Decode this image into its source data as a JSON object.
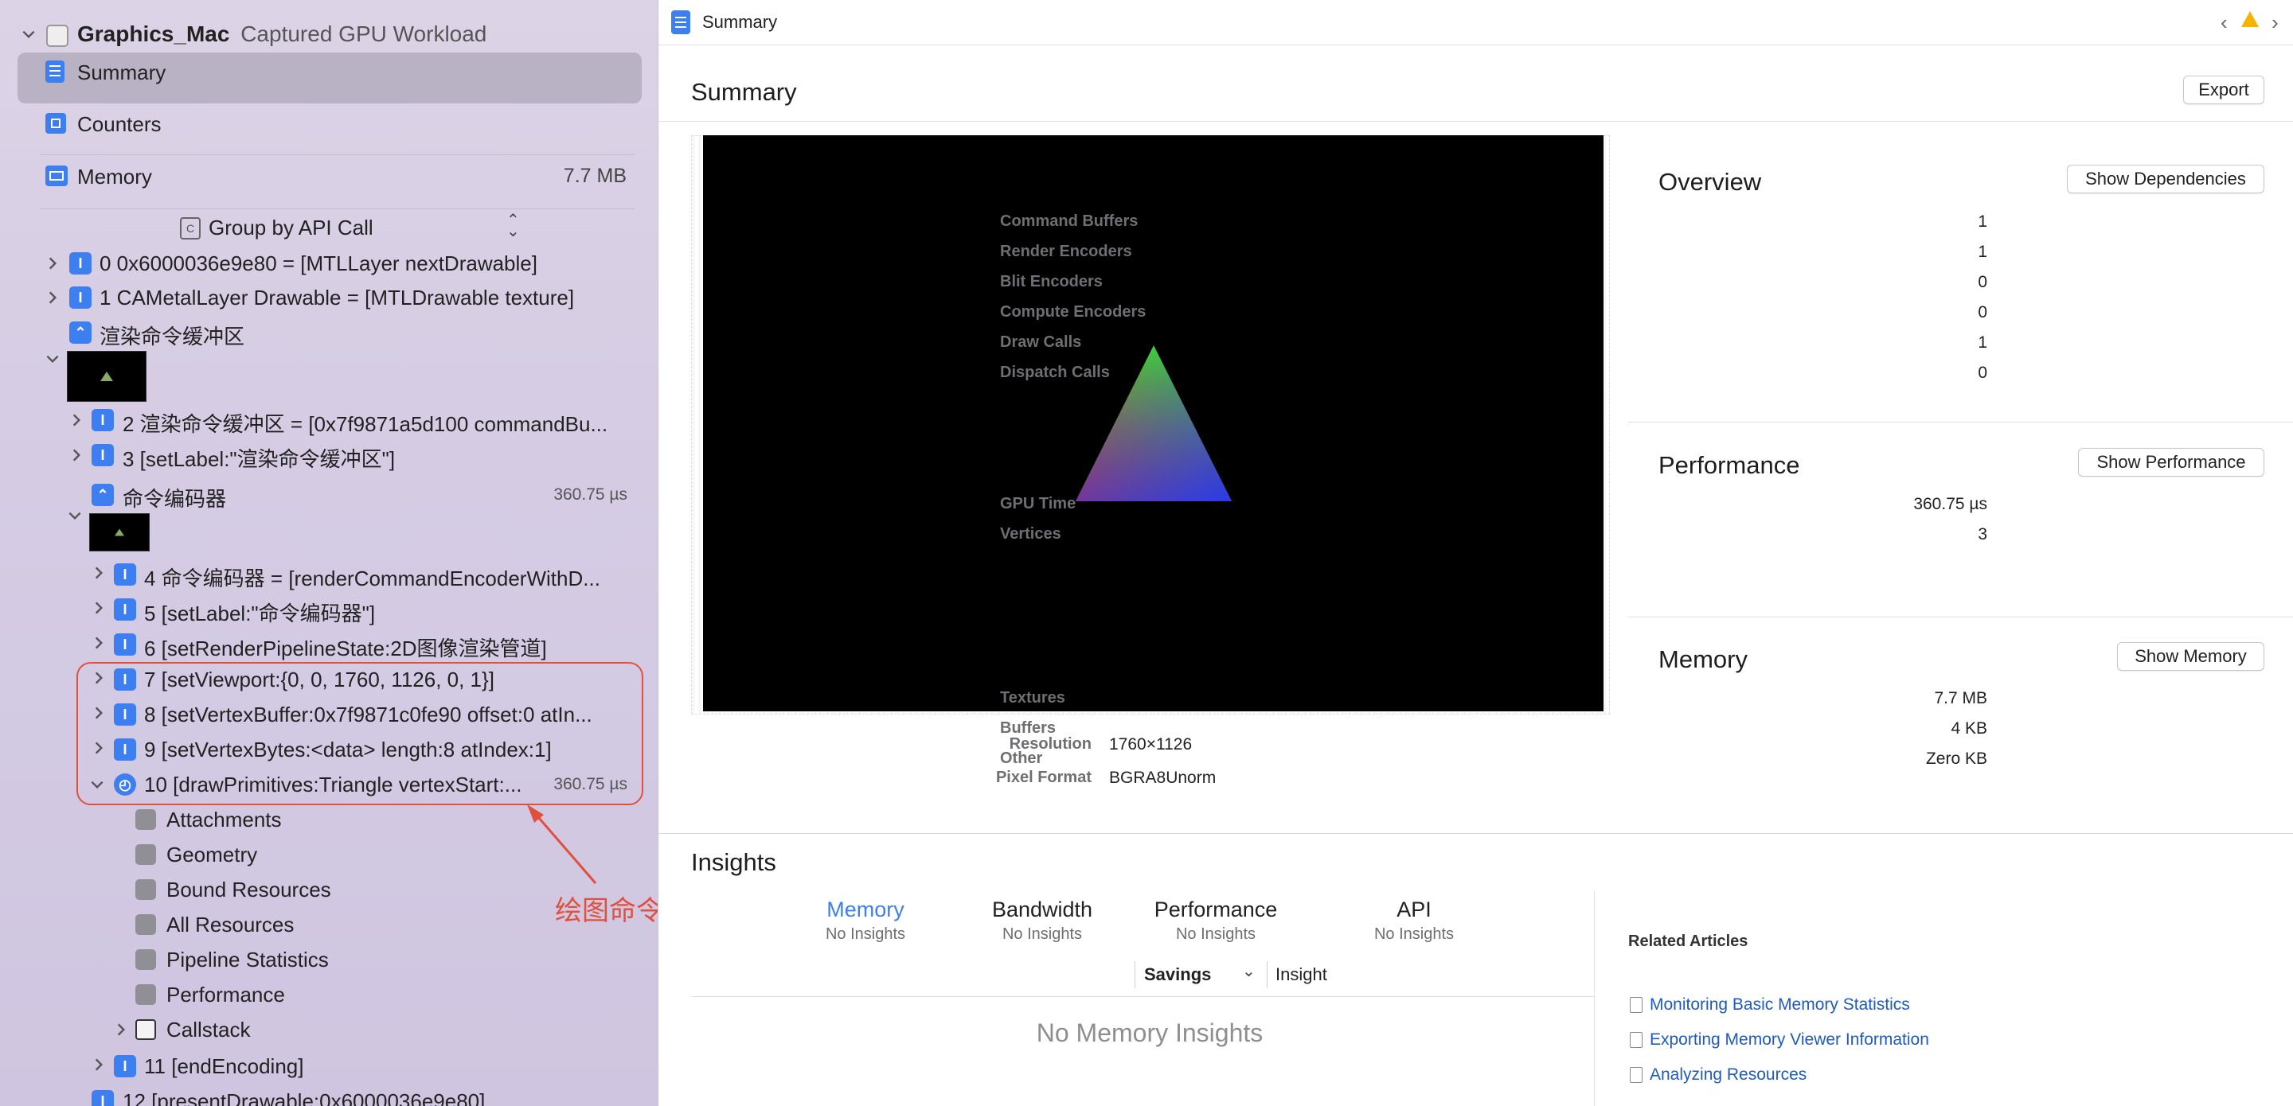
{
  "colors": {
    "accent": "#3d7ef0",
    "highlight_border": "#e0503c",
    "link": "#1f5bbf",
    "warning": "#f4b400"
  },
  "sidebar": {
    "project_name": "Graphics_Mac",
    "project_subtitle": "Captured GPU Workload",
    "nav": {
      "summary": "Summary",
      "counters": "Counters",
      "memory": "Memory",
      "memory_value": "7.7 MB"
    },
    "group_by": "Group by API Call",
    "calls": {
      "c0": "0 0x6000036e9e80 = [MTLLayer nextDrawable]",
      "c1": "1 CAMetalLayer Drawable = [MTLDrawable texture]",
      "render_buffer": "渲染命令缓冲区",
      "c2": "2 渲染命令缓冲区 = [0x7f9871a5d100 commandBu...",
      "c3": "3 [setLabel:\"渲染命令缓冲区\"]",
      "encoder": "命令编码器",
      "encoder_dur": "360.75 µs",
      "c4": "4 命令编码器 = [renderCommandEncoderWithD...",
      "c5": "5 [setLabel:\"命令编码器\"]",
      "c6": "6 [setRenderPipelineState:2D图像渲染管道]",
      "c7": "7 [setViewport:{0, 0, 1760, 1126, 0, 1}]",
      "c8": "8 [setVertexBuffer:0x7f9871c0fe90 offset:0 atIn...",
      "c9": "9 [setVertexBytes:<data> length:8 atIndex:1]",
      "c10": "10 [drawPrimitives:Triangle vertexStart:...",
      "c10_dur": "360.75 µs",
      "sub": {
        "attachments": "Attachments",
        "geometry": "Geometry",
        "bound": "Bound Resources",
        "all": "All Resources",
        "pipeline": "Pipeline Statistics",
        "performance": "Performance",
        "callstack": "Callstack"
      },
      "c11": "11 [endEncoding]",
      "c12": "12 [presentDrawable:0x6000036e9e80]"
    },
    "annotation": "绘图命令"
  },
  "topbar": {
    "title": "Summary"
  },
  "summary": {
    "title": "Summary",
    "export": "Export",
    "resolution_label": "Resolution",
    "resolution_value": "1760×1126",
    "pixel_format_label": "Pixel Format",
    "pixel_format_value": "BGRA8Unorm"
  },
  "overview": {
    "title": "Overview",
    "button": "Show Dependencies",
    "rows": [
      {
        "label": "Command Buffers",
        "value": "1"
      },
      {
        "label": "Render Encoders",
        "value": "1"
      },
      {
        "label": "Blit Encoders",
        "value": "0"
      },
      {
        "label": "Compute Encoders",
        "value": "0"
      },
      {
        "label": "Draw Calls",
        "value": "1"
      },
      {
        "label": "Dispatch Calls",
        "value": "0"
      }
    ]
  },
  "performance": {
    "title": "Performance",
    "button": "Show Performance",
    "rows": [
      {
        "label": "GPU Time",
        "value": "360.75 µs"
      },
      {
        "label": "Vertices",
        "value": "3"
      }
    ]
  },
  "memory": {
    "title": "Memory",
    "button": "Show Memory",
    "rows": [
      {
        "label": "Textures",
        "value": "7.7 MB"
      },
      {
        "label": "Buffers",
        "value": "4 KB"
      },
      {
        "label": "Other",
        "value": "Zero KB"
      }
    ]
  },
  "insights": {
    "title": "Insights",
    "tabs": [
      {
        "label": "Memory",
        "sub": "No Insights"
      },
      {
        "label": "Bandwidth",
        "sub": "No Insights"
      },
      {
        "label": "Performance",
        "sub": "No Insights"
      },
      {
        "label": "API",
        "sub": "No Insights"
      }
    ],
    "col_savings": "Savings",
    "col_insight": "Insight",
    "empty": "No Memory Insights",
    "related_title": "Related Articles",
    "articles": [
      "Monitoring Basic Memory Statistics",
      "Exporting Memory Viewer Information",
      "Analyzing Resources"
    ]
  }
}
